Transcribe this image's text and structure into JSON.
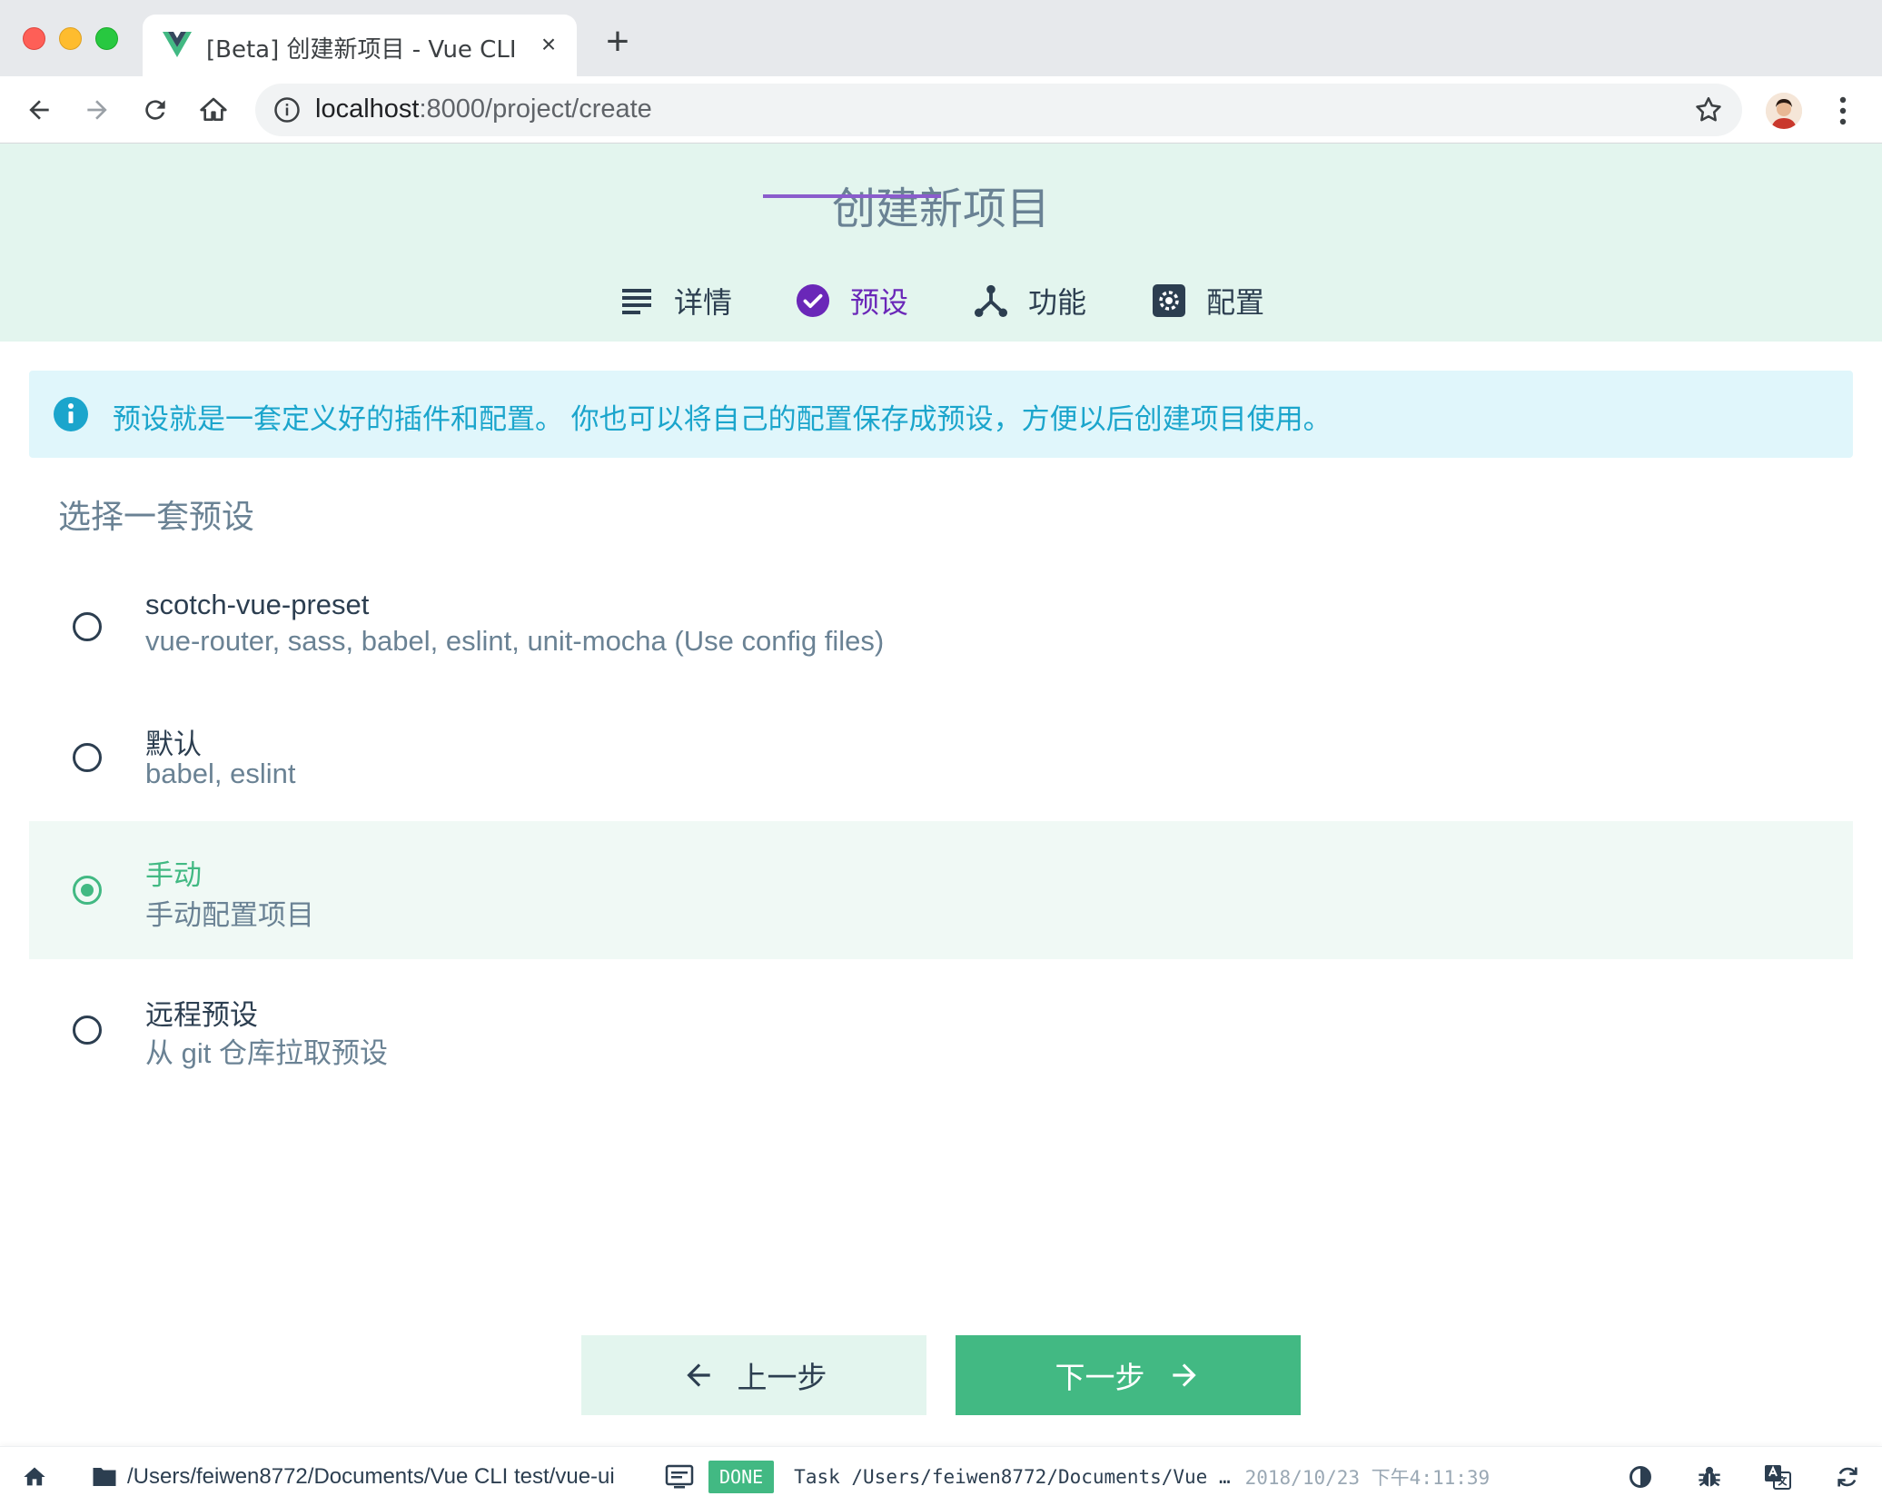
{
  "browser": {
    "tab_title": "[Beta] 创建新项目 - Vue CLI",
    "tab_close": "×",
    "new_tab": "+",
    "url_host": "localhost",
    "url_rest": ":8000/project/create"
  },
  "header": {
    "title": "创建新项目",
    "steps": [
      {
        "label": "详情",
        "icon": "list-icon"
      },
      {
        "label": "预设",
        "icon": "check-circle-icon"
      },
      {
        "label": "功能",
        "icon": "fork-icon"
      },
      {
        "label": "配置",
        "icon": "gear-icon"
      }
    ],
    "active_step": 1
  },
  "info": {
    "text": "预设就是一套定义好的插件和配置。 你也可以将自己的配置保存成预设，方便以后创建项目使用。"
  },
  "presets": {
    "section_title": "选择一套预设",
    "items": [
      {
        "name": "scotch-vue-preset",
        "desc": "vue-router, sass, babel, eslint, unit-mocha (Use config files)",
        "selected": false
      },
      {
        "name": "默认",
        "desc": "babel, eslint",
        "selected": false
      },
      {
        "name": "手动",
        "desc": "手动配置项目",
        "selected": true
      },
      {
        "name": "远程预设",
        "desc": "从 git 仓库拉取预设",
        "selected": false
      }
    ]
  },
  "actions": {
    "prev_label": "上一步",
    "next_label": "下一步"
  },
  "status_bar": {
    "path": "/Users/feiwen8772/Documents/Vue CLI test/vue-ui",
    "badge": "DONE",
    "task_text": "Task /Users/feiwen8772/Documents/Vue …",
    "timestamp": "2018/10/23 下午4:11:39"
  },
  "colors": {
    "accent": "#42b983",
    "header_bg": "#e3f5ee",
    "active_step": "#6a27b8",
    "info": "#1ba5cc"
  }
}
